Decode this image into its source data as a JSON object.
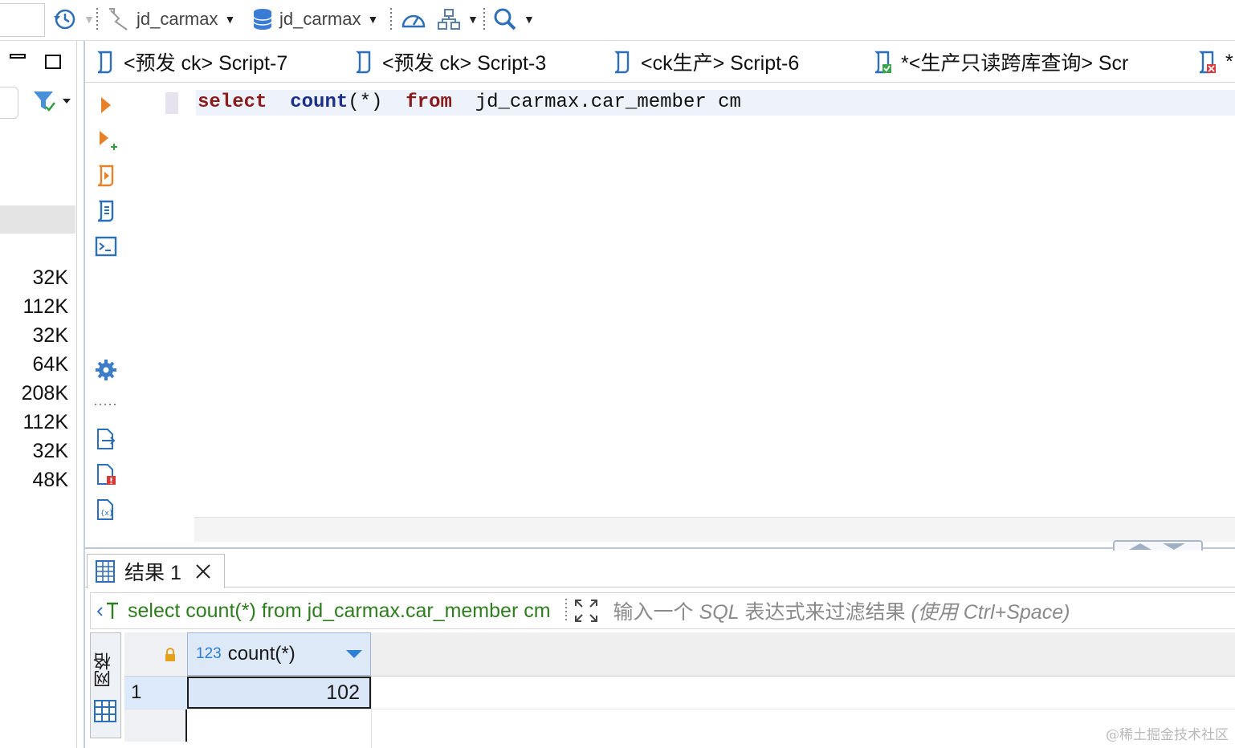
{
  "toolbar": {
    "connection_label": "jd_carmax",
    "database_label": "jd_carmax"
  },
  "left_panel": {
    "sizes": [
      "32K",
      "112K",
      "32K",
      "64K",
      "208K",
      "112K",
      "32K",
      "48K"
    ]
  },
  "editor_tabs": [
    {
      "label": "<预发 ck> Script-7"
    },
    {
      "label": "<预发 ck> Script-3"
    },
    {
      "label": "<ck生产> Script-6"
    },
    {
      "label": "*<生产只读跨库查询> Scr"
    },
    {
      "label": "*"
    }
  ],
  "editor": {
    "kw_select": "select",
    "kw_count": "count",
    "count_arg": "(*)",
    "kw_from": "from",
    "table_ref": "jd_carmax.car_member cm"
  },
  "results": {
    "tab_label": "结果 1",
    "query_text": "select count(*) from jd_carmax.car_member cm",
    "filter_placeholder_cn": "输入一个",
    "filter_placeholder_sql": "SQL",
    "filter_placeholder_cn2": "表达式来过滤结果",
    "filter_placeholder_hint": "(使用 Ctrl+Space)",
    "side_label": "网格",
    "column_type": "123",
    "column_name": "count(*)",
    "row_number": "1",
    "cell_value": "102"
  },
  "watermark": "@稀土掘金技术社区",
  "colors": {
    "keyword_red": "#8b1c1c",
    "keyword_blue": "#1b2f8a",
    "query_green": "#2e7d1e",
    "selection_blue": "#d9e7f8",
    "accent_blue": "#2d7fd3"
  }
}
